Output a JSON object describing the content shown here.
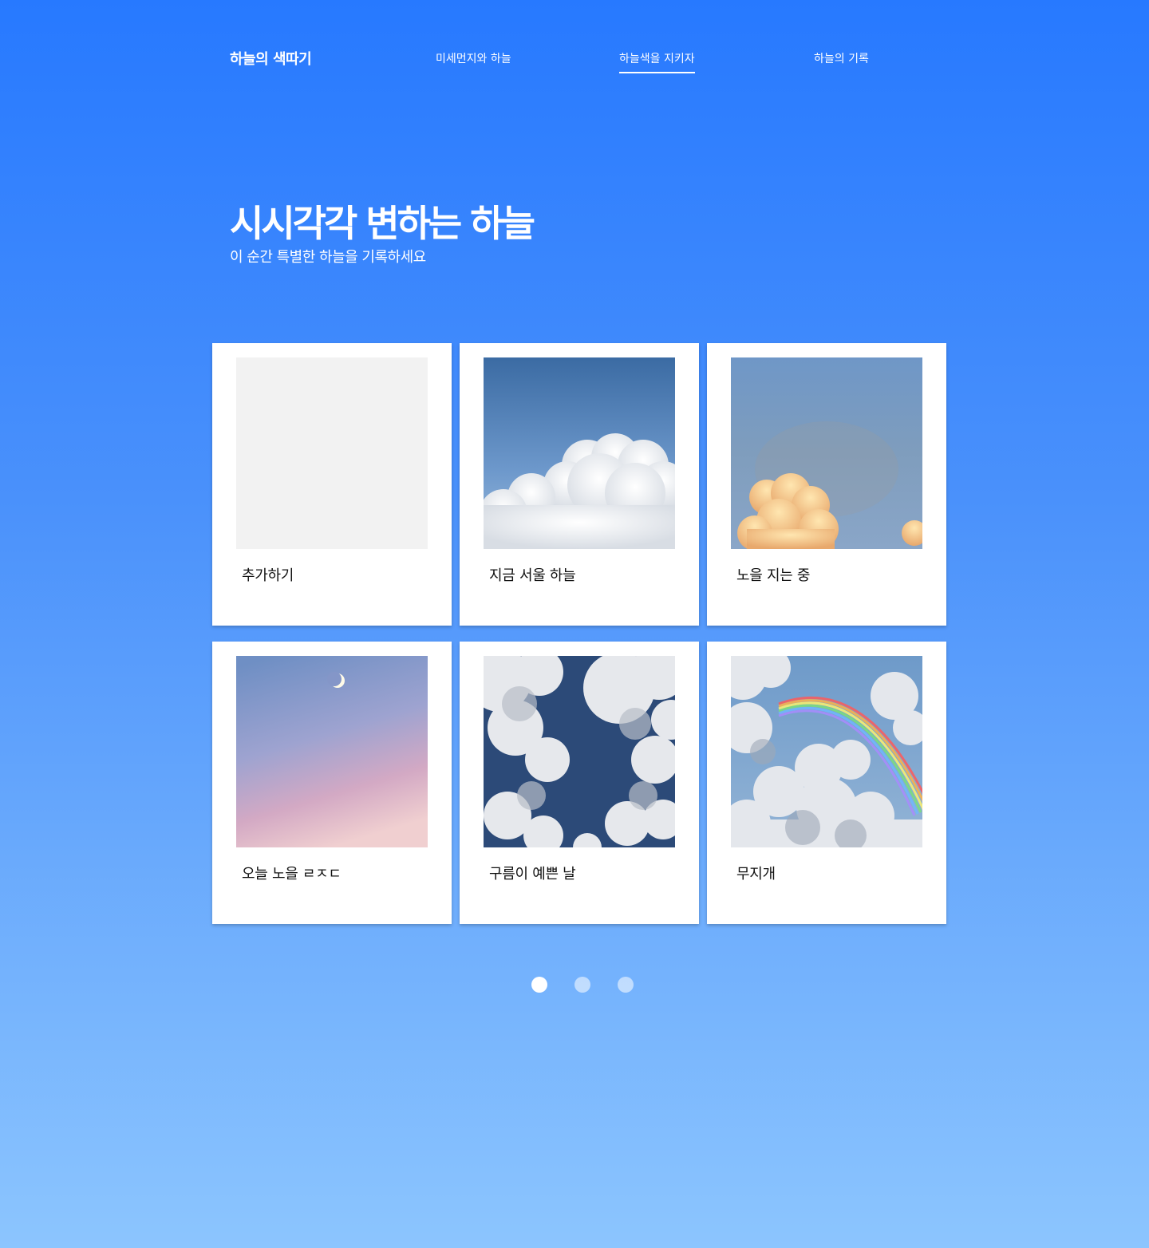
{
  "nav": {
    "logo": "하늘의 색따기",
    "links": [
      {
        "label": "미세먼지와 하늘",
        "active": false
      },
      {
        "label": "하늘색을 지키자",
        "active": true
      },
      {
        "label": "하늘의 기록",
        "active": false
      }
    ]
  },
  "hero": {
    "title": "시시각각 변하는 하늘",
    "subtitle": "이 순간 특별한 하늘을 기록하세요"
  },
  "cards": [
    {
      "caption": "추가하기",
      "image": "placeholder"
    },
    {
      "caption": "지금 서울 하늘",
      "image": "cumulus-clouds"
    },
    {
      "caption": "노을 지는 중",
      "image": "sunset-clouds"
    },
    {
      "caption": "오늘 노을 ㄹㅈㄷ",
      "image": "pink-sky-moon"
    },
    {
      "caption": "구름이 예쁜 날",
      "image": "scattered-clouds"
    },
    {
      "caption": "무지개",
      "image": "rainbow-clouds"
    }
  ],
  "pagination": {
    "pages": 3,
    "current": 1
  },
  "colors": {
    "gradient_top": "#2779ff",
    "gradient_bottom": "#8cc5fe",
    "card_bg": "#ffffff",
    "placeholder_bg": "#f2f2f2"
  }
}
